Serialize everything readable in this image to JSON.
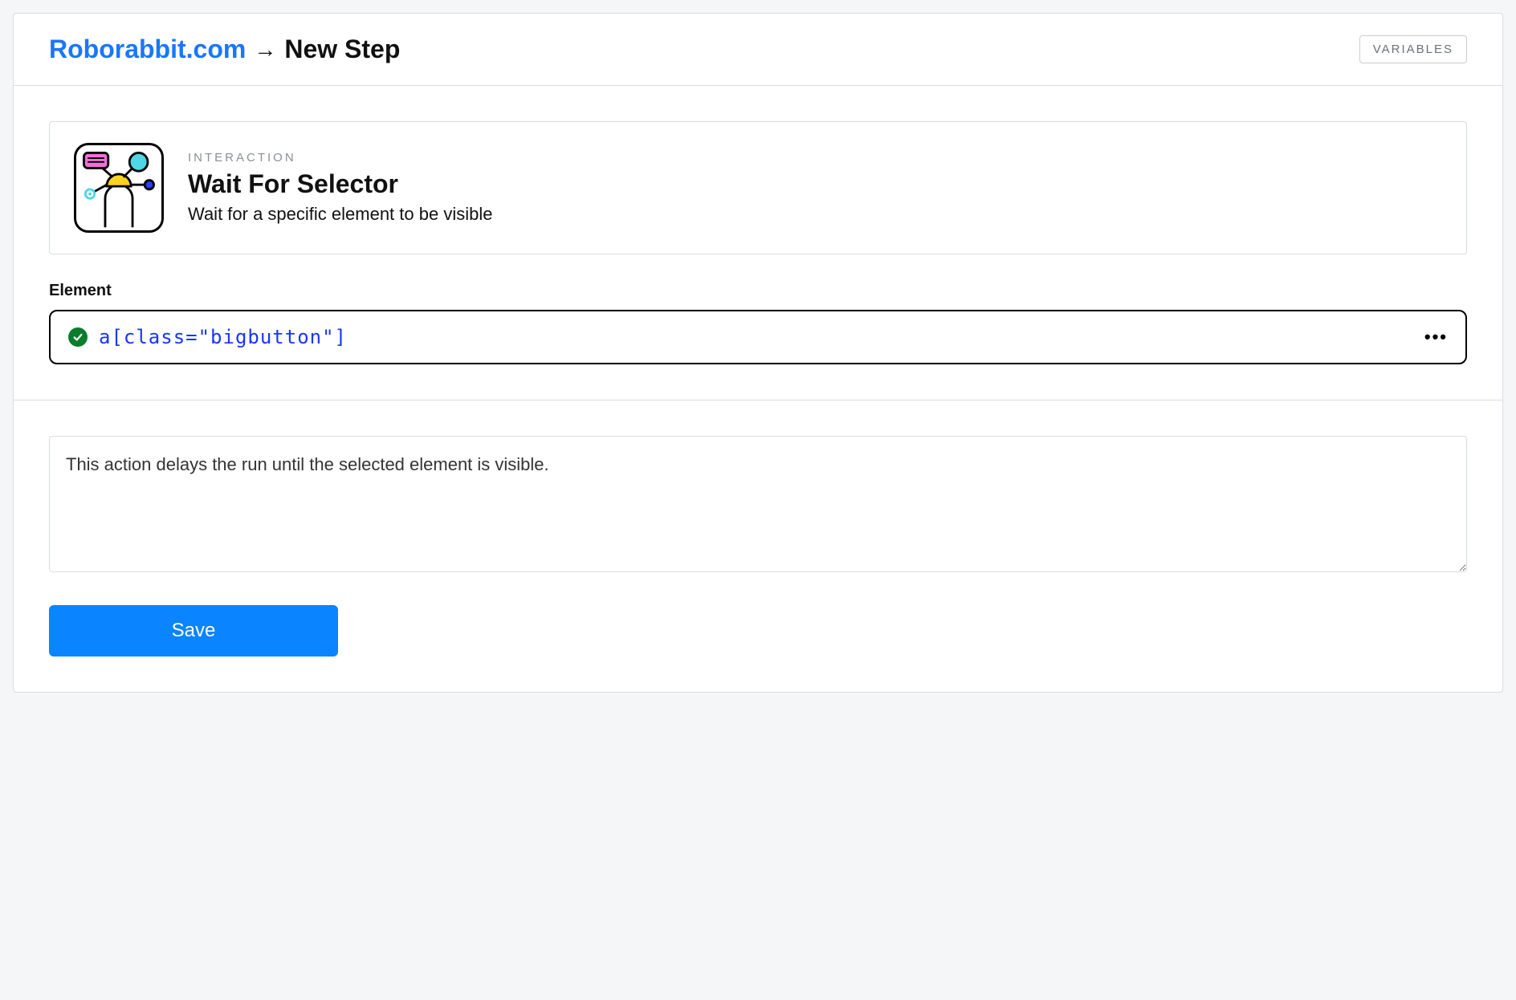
{
  "breadcrumb": {
    "site": "Roborabbit.com",
    "arrow": "→",
    "current": "New Step"
  },
  "header": {
    "variables_button": "VARIABLES"
  },
  "step": {
    "eyebrow": "INTERACTION",
    "title": "Wait For Selector",
    "description": "Wait for a specific element to be visible"
  },
  "element_field": {
    "label": "Element",
    "value": "a[class=\"bigbutton\"]"
  },
  "notes": {
    "value": "This action delays the run until the selected element is visible."
  },
  "actions": {
    "save_label": "Save"
  }
}
